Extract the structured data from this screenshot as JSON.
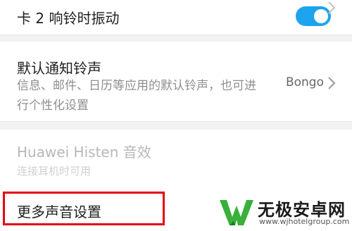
{
  "settings": {
    "vibrate": {
      "title": "卡 2 响铃时振动",
      "enabled": true
    },
    "notification_ringtone": {
      "title": "默认通知铃声",
      "subtitle": "信息、邮件、日历等应用的默认铃声，也可进行个性化设置",
      "value": "Bongo"
    },
    "histen": {
      "title": "Huawei Histen 音效",
      "subtitle": "连接耳机时可用"
    },
    "more_sound": {
      "title": "更多声音设置"
    }
  },
  "watermark": {
    "name": "无极安卓网",
    "url": "www.wjhotelgroup.com"
  },
  "colors": {
    "toggle_on": "#1ea3ef",
    "highlight": "#e60012",
    "logo_green": "#38b03a"
  },
  "icons": {
    "chevron": "chevron-right-icon",
    "toggle": "toggle-switch"
  }
}
